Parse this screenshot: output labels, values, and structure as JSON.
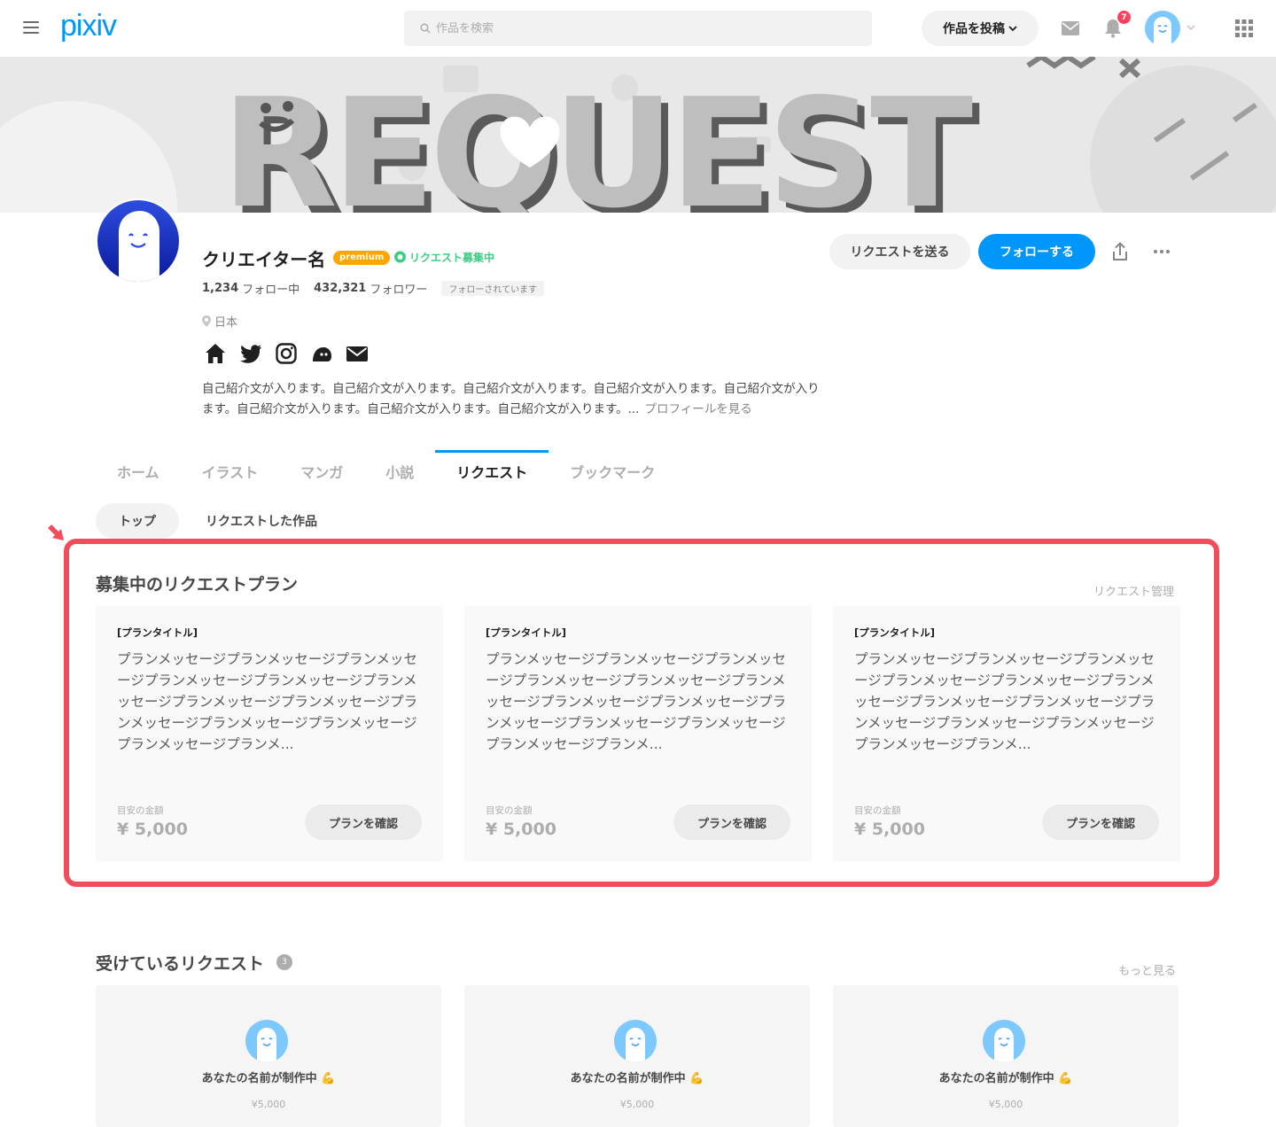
{
  "header": {
    "logo": "pixiv",
    "search_placeholder": "作品を検索",
    "post_button": "作品を投稿",
    "notification_count": "7"
  },
  "profile": {
    "name": "クリエイター名",
    "premium_badge": "premium",
    "request_status": "リクエスト募集中",
    "following_count": "1,234",
    "following_label": "フォロー中",
    "followers_count": "432,321",
    "followers_label": "フォロワー",
    "followed_tag": "フォローされています",
    "location": "日本",
    "bio": "自己紹介文が入ります。自己紹介文が入ります。自己紹介文が入ります。自己紹介文が入ります。自己紹介文が入ります。自己紹介文が入ります。自己紹介文が入ります。自己紹介文が入ります。...",
    "bio_more": "プロフィールを見る",
    "send_request_button": "リクエストを送る",
    "follow_button": "フォローする"
  },
  "tabs": [
    "ホーム",
    "イラスト",
    "マンガ",
    "小説",
    "リクエスト",
    "ブックマーク"
  ],
  "active_tab": "リクエスト",
  "subtabs": [
    "トップ",
    "リクエストした作品"
  ],
  "plans_section": {
    "title": "募集中のリクエストプラン",
    "manage_link": "リクエスト管理",
    "plans": [
      {
        "title": "[プランタイトル]",
        "message": "プランメッセージプランメッセージプランメッセージプランメッセージプランメッセージプランメッセージプランメッセージプランメッセージプランメッセージプランメッセージプランメッセージプランメッセージプランメ...",
        "price_label": "目安の金額",
        "price": "¥ 5,000",
        "button": "プランを確認"
      },
      {
        "title": "[プランタイトル]",
        "message": "プランメッセージプランメッセージプランメッセージプランメッセージプランメッセージプランメッセージプランメッセージプランメッセージプランメッセージプランメッセージプランメッセージプランメッセージプランメ...",
        "price_label": "目安の金額",
        "price": "¥ 5,000",
        "button": "プランを確認"
      },
      {
        "title": "[プランタイトル]",
        "message": "プランメッセージプランメッセージプランメッセージプランメッセージプランメッセージプランメッセージプランメッセージプランメッセージプランメッセージプランメッセージプランメッセージプランメッセージプランメ...",
        "price_label": "目安の金額",
        "price": "¥ 5,000",
        "button": "プランを確認"
      }
    ]
  },
  "received_section": {
    "title": "受けているリクエスト",
    "count": "3",
    "more_link": "もっと見る",
    "cards": [
      {
        "text": "あなたの名前が制作中 💪",
        "price": "¥5,000"
      },
      {
        "text": "あなたの名前が制作中 💪",
        "price": "¥5,000"
      },
      {
        "text": "あなたの名前が制作中 💪",
        "price": "¥5,000"
      }
    ]
  },
  "colors": {
    "accent": "#0096fa",
    "premium": "#ffa500",
    "request_green": "#3ccc83",
    "highlight_frame": "#f34c5a"
  }
}
